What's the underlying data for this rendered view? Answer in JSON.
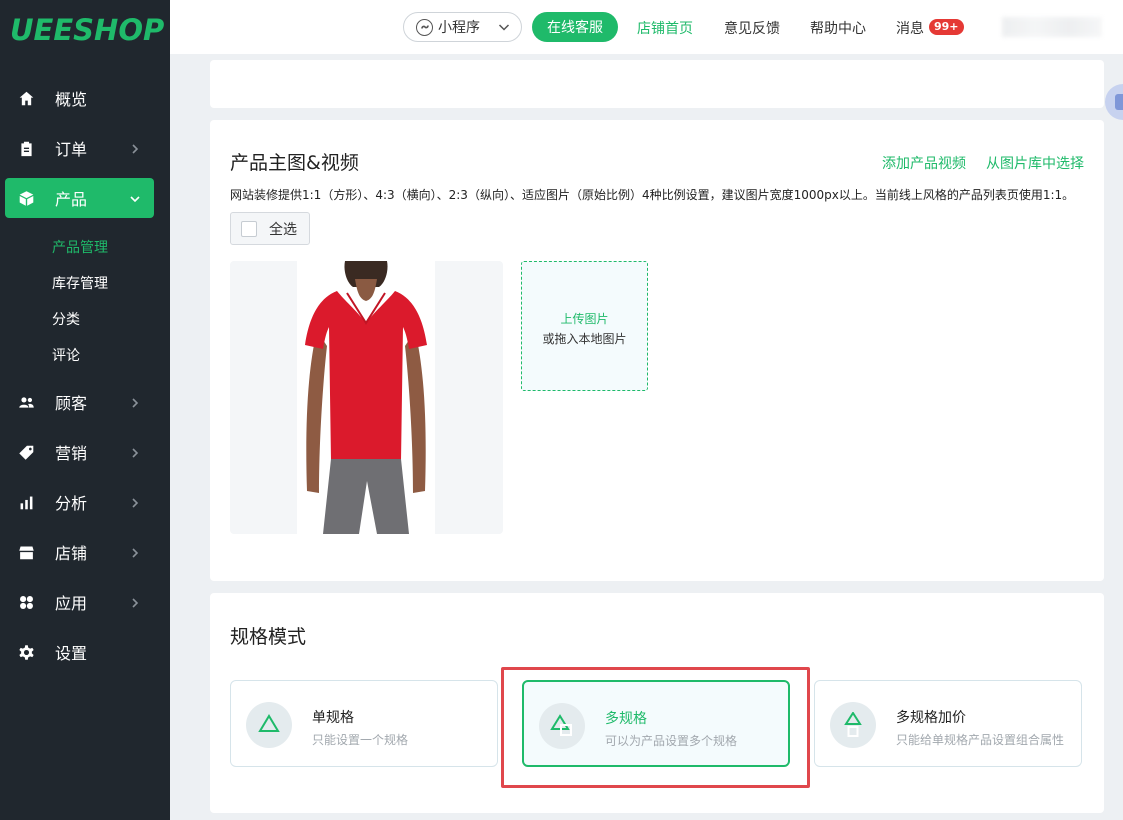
{
  "brand": {
    "logo": "UEESHOP",
    "color": "#1fba6a"
  },
  "sidebar": {
    "items": [
      {
        "label": "概览",
        "icon": "home-icon"
      },
      {
        "label": "订单",
        "icon": "clipboard-icon"
      },
      {
        "label": "产品",
        "icon": "box-icon",
        "active": true
      },
      {
        "label": "顾客",
        "icon": "users-icon"
      },
      {
        "label": "营销",
        "icon": "tag-icon"
      },
      {
        "label": "分析",
        "icon": "bar-chart-icon"
      },
      {
        "label": "店铺",
        "icon": "store-icon"
      },
      {
        "label": "应用",
        "icon": "apps-icon"
      },
      {
        "label": "设置",
        "icon": "gear-icon"
      }
    ],
    "sub_items": [
      {
        "label": "产品管理",
        "active": true
      },
      {
        "label": "库存管理"
      },
      {
        "label": "分类"
      },
      {
        "label": "评论"
      }
    ]
  },
  "topbar": {
    "mini_program": "小程序",
    "online_service": "在线客服",
    "store_home": "店铺首页",
    "feedback": "意见反馈",
    "help": "帮助中心",
    "messages": "消息",
    "messages_badge": "99+"
  },
  "media": {
    "title": "产品主图&视频",
    "add_video": "添加产品视频",
    "from_library": "从图片库中选择",
    "note": "网站装修提供1:1（方形）、4:3（横向）、2:3（纵向）、适应图片（原始比例）4种比例设置，建议图片宽度1000px以上。当前线上风格的产品列表页使用1:1。",
    "select_all": "全选",
    "upload_title": "上传图片",
    "upload_sub": "或拖入本地图片"
  },
  "spec": {
    "title": "规格模式",
    "options": [
      {
        "title": "单规格",
        "desc": "只能设置一个规格"
      },
      {
        "title": "多规格",
        "desc": "可以为产品设置多个规格",
        "selected": true
      },
      {
        "title": "多规格加价",
        "desc": "只能给单规格产品设置组合属性"
      }
    ]
  }
}
